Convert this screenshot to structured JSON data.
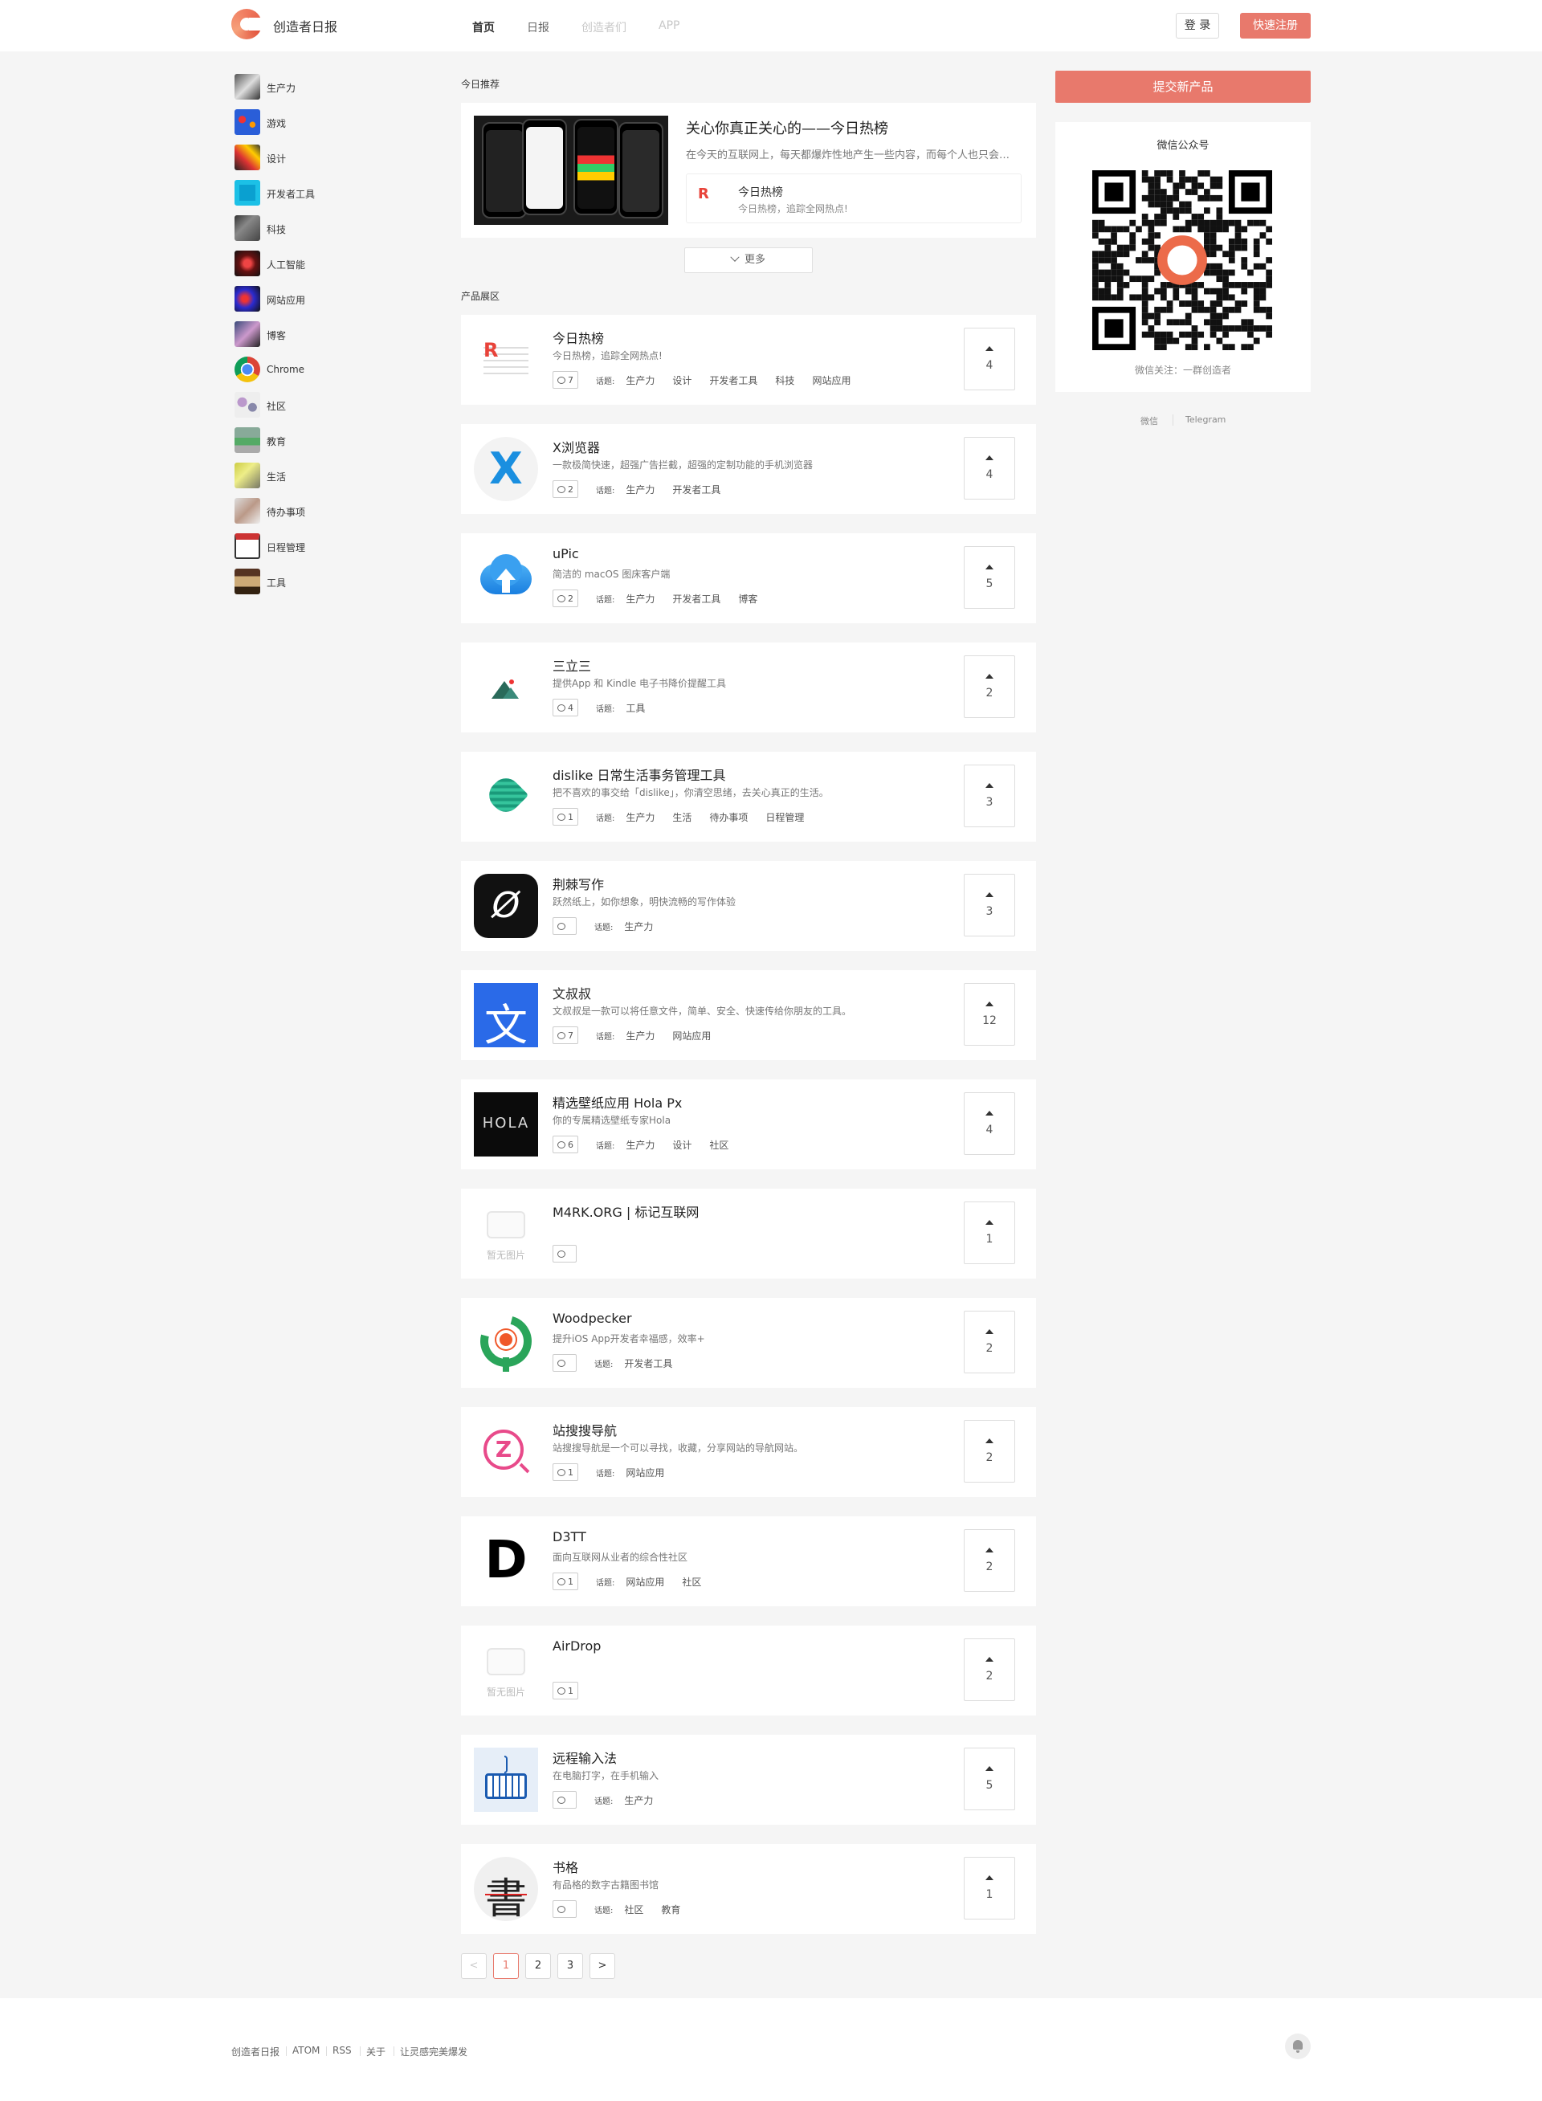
{
  "header": {
    "brand": "创造者日报",
    "nav": [
      "首页",
      "日报",
      "创造者们",
      "APP"
    ],
    "login": "登 录",
    "register": "快速注册"
  },
  "sidebar": {
    "items": [
      {
        "label": "生产力"
      },
      {
        "label": "游戏"
      },
      {
        "label": "设计"
      },
      {
        "label": "开发者工具"
      },
      {
        "label": "科技"
      },
      {
        "label": "人工智能"
      },
      {
        "label": "网站应用"
      },
      {
        "label": "博客"
      },
      {
        "label": "Chrome"
      },
      {
        "label": "社区"
      },
      {
        "label": "教育"
      },
      {
        "label": "生活"
      },
      {
        "label": "待办事项"
      },
      {
        "label": "日程管理"
      },
      {
        "label": "工具"
      }
    ]
  },
  "featured": {
    "section_title": "今日推荐",
    "title": "关心你真正关心的——今日热榜",
    "desc": "在今天的互联网上，每天都爆炸性地产生一些内容，而每个人也只会关心其中的一小部分……",
    "mini_logo": "R",
    "mini_title": "今日热榜",
    "mini_desc": "今日热榜，追踪全网热点!",
    "more": "更多"
  },
  "products": {
    "section_title": "产品展区",
    "topic_label": "话题:",
    "no_image": "暂无图片",
    "items": [
      {
        "title": "今日热榜",
        "desc": "今日热榜，追踪全网热点!",
        "comments": "7",
        "topics": [
          "生产力",
          "设计",
          "开发者工具",
          "科技",
          "网站应用"
        ],
        "votes": "4"
      },
      {
        "title": "X浏览器",
        "desc": "一款极简快速，超强广告拦截，超强的定制功能的手机浏览器",
        "comments": "2",
        "topics": [
          "生产力",
          "开发者工具"
        ],
        "votes": "4"
      },
      {
        "title": "uPic",
        "desc": "简洁的 macOS 图床客户端",
        "comments": "2",
        "topics": [
          "生产力",
          "开发者工具",
          "博客"
        ],
        "votes": "5"
      },
      {
        "title": "三立三",
        "desc": "提供App 和 Kindle 电子书降价提醒工具",
        "comments": "4",
        "topics": [
          "工具"
        ],
        "votes": "2"
      },
      {
        "title": "dislike 日常生活事务管理工具",
        "desc": "把不喜欢的事交给「dislike」，你清空思绪，去关心真正的生活。",
        "comments": "1",
        "topics": [
          "生产力",
          "生活",
          "待办事项",
          "日程管理"
        ],
        "votes": "3"
      },
      {
        "title": "荆棘写作",
        "desc": "跃然纸上，如你想象，明快流畅的写作体验",
        "comments": "",
        "topics": [
          "生产力"
        ],
        "votes": "3"
      },
      {
        "title": "文叔叔",
        "desc": "文叔叔是一款可以将任意文件，简单、安全、快速传给你朋友的工具。",
        "comments": "7",
        "topics": [
          "生产力",
          "网站应用"
        ],
        "votes": "12"
      },
      {
        "title": "精选壁纸应用 Hola Px",
        "desc": "你的专属精选壁纸专家Hola",
        "comments": "6",
        "topics": [
          "生产力",
          "设计",
          "社区"
        ],
        "votes": "4"
      },
      {
        "title": "M4RK.ORG | 标记互联网",
        "desc": "",
        "comments": "",
        "topics": [],
        "votes": "1"
      },
      {
        "title": "Woodpecker",
        "desc": "提升iOS App开发者幸福感，效率+",
        "comments": "",
        "topics": [
          "开发者工具"
        ],
        "votes": "2"
      },
      {
        "title": "站搜搜导航",
        "desc": "站搜搜导航是一个可以寻找，收藏，分享网站的导航网站。",
        "comments": "1",
        "topics": [
          "网站应用"
        ],
        "votes": "2"
      },
      {
        "title": "D3TT",
        "desc": "面向互联网从业者的综合性社区",
        "comments": "1",
        "topics": [
          "网站应用",
          "社区"
        ],
        "votes": "2"
      },
      {
        "title": "AirDrop",
        "desc": "",
        "comments": "1",
        "topics": [],
        "votes": "2"
      },
      {
        "title": "远程输入法",
        "desc": "在电脑打字，在手机输入",
        "comments": "",
        "topics": [
          "生产力"
        ],
        "votes": "5"
      },
      {
        "title": "书格",
        "desc": "有品格的数字古籍图书馆",
        "comments": "",
        "topics": [
          "社区",
          "教育"
        ],
        "votes": "1"
      }
    ]
  },
  "logos": {
    "holala": "HOLA",
    "wen": "文",
    "d3tt": "D",
    "shuge": "書",
    "jinji": "Ø",
    "zhan": "Z",
    "r": "R"
  },
  "pagination": {
    "prev": "<",
    "pages": [
      "1",
      "2",
      "3"
    ],
    "next": ">",
    "current": "1"
  },
  "right": {
    "submit": "提交新产品",
    "wechat_title": "微信公众号",
    "wechat_caption": "微信关注：一群创造者",
    "links": [
      "微信",
      "Telegram"
    ]
  },
  "footer": {
    "links": [
      "创造者日报",
      "ATOM",
      "RSS",
      "关于",
      "让灵感完美爆发"
    ]
  },
  "colors": {
    "accent": "#e8796c",
    "background": "#f5f5f5"
  }
}
